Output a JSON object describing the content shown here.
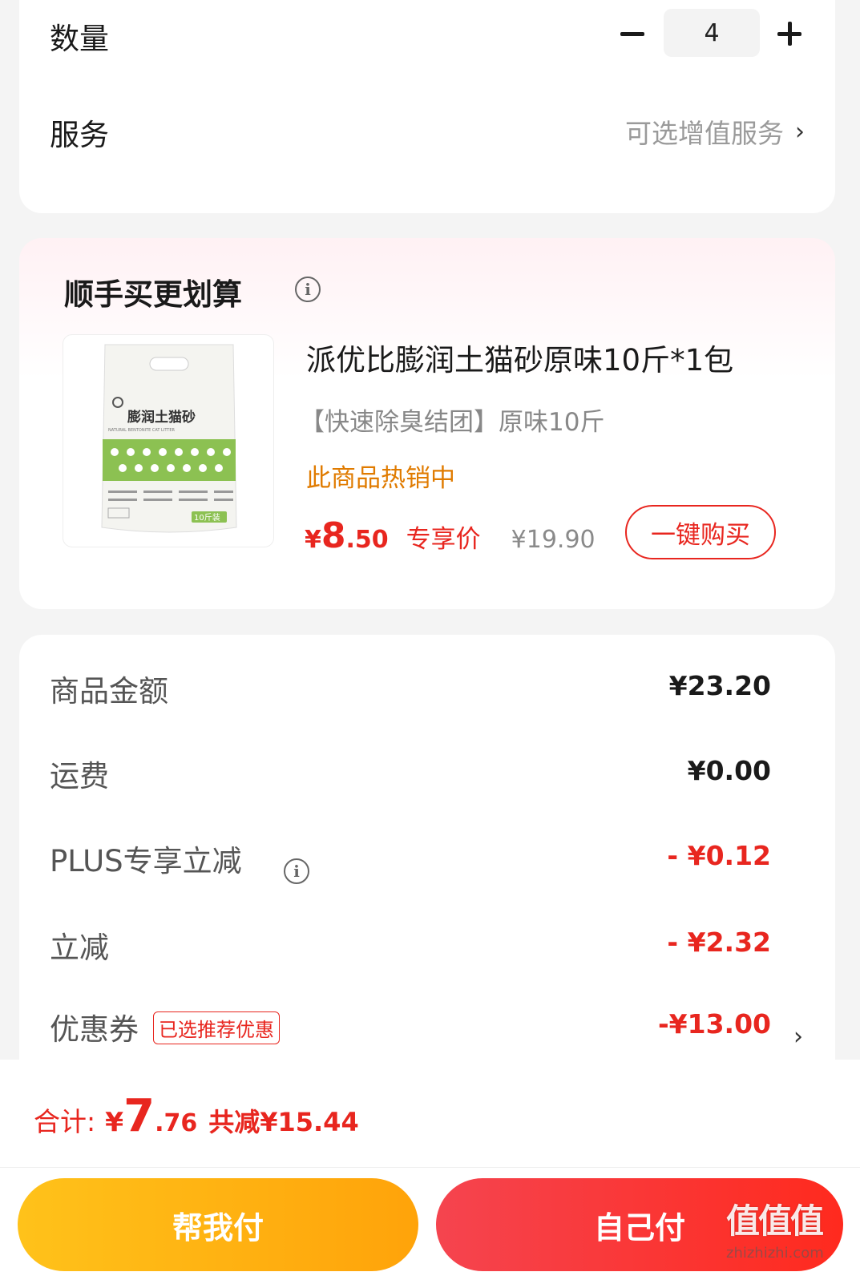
{
  "quantity": {
    "label": "数量",
    "value": "4"
  },
  "service": {
    "label": "服务",
    "hint": "可选增值服务",
    "chevron": "›"
  },
  "bundle": {
    "title": "顺手买更划算",
    "info_icon": "i",
    "product": {
      "name": "派优比膨润土猫砂原味10斤*1包",
      "spec": "【快速除臭结团】原味10斤",
      "hot": "此商品热销中",
      "thumb_text": "膨润土猫砂",
      "thumb_sub": "NATURAL BENTONITE CAT LITTER",
      "thumb_badge": "10斤装",
      "price_currency": "¥",
      "price_int": "8",
      "price_dec": ".50",
      "price_tag": "专享价",
      "price_original": "¥19.90",
      "buy_label": "一键购买"
    }
  },
  "summary": {
    "rows": [
      {
        "label": "商品金额",
        "value": "¥23.20"
      },
      {
        "label": "运费",
        "value": "¥0.00"
      },
      {
        "label": "PLUS专享立减",
        "value": "- ¥0.12"
      },
      {
        "label": "立减",
        "value": "- ¥2.32"
      },
      {
        "label": "优惠券",
        "value": "-¥13.00",
        "badge": "已选推荐优惠"
      }
    ]
  },
  "bottom": {
    "total_label": "合计:",
    "total_currency": "¥",
    "total_int": "7",
    "total_dec": ".76",
    "total_saved": "共减¥15.44",
    "help_pay": "帮我付",
    "self_pay": "自己付"
  },
  "watermark": {
    "text": "值值值",
    "domain": "zhizhizhi.com"
  },
  "colors": {
    "accent_red": "#e8261f",
    "orange": "#e07b00",
    "yellow_btn": "#ffb312",
    "red_btn": "#f5444f"
  },
  "icons": [
    "minus-icon",
    "plus-icon",
    "chevron-right-icon",
    "info-icon"
  ]
}
